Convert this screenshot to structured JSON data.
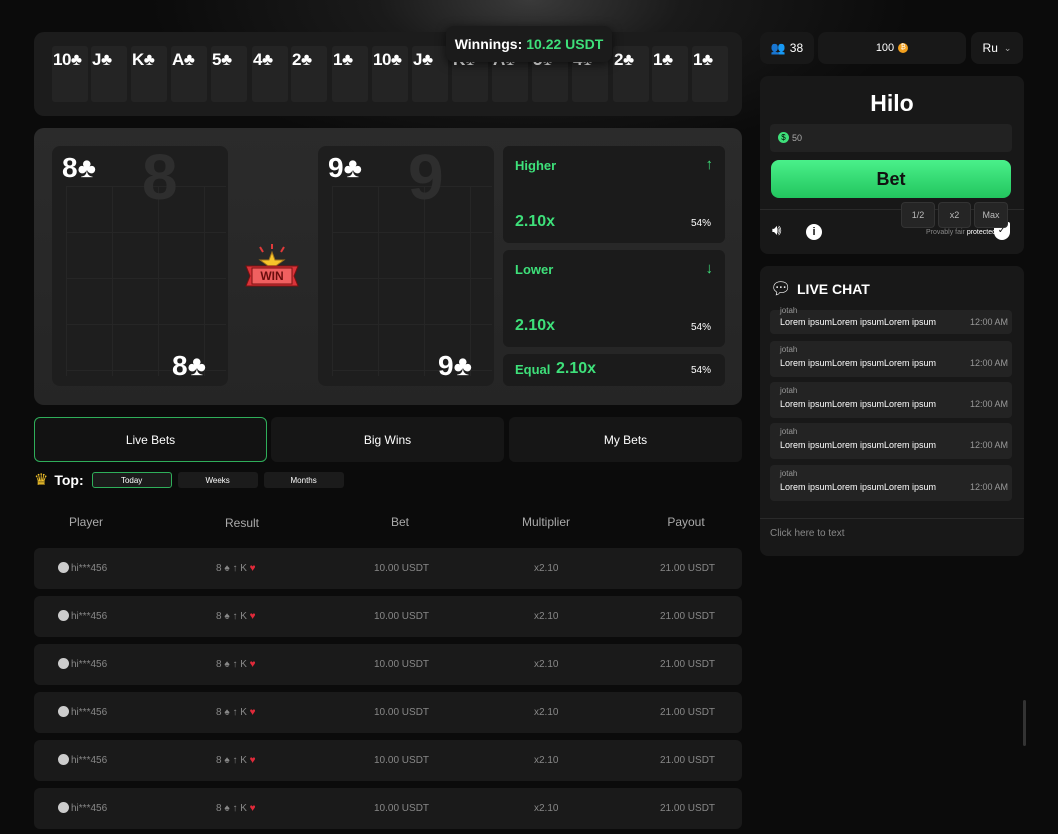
{
  "history": {
    "cards": [
      "10♣",
      "J♣",
      "K♣",
      "A♣",
      "5♣",
      "4♣",
      "2♣",
      "1♣",
      "10♣",
      "J♣",
      "K♣",
      "A♣",
      "5♣",
      "4♣",
      "2♣",
      "1♣",
      "1♣"
    ]
  },
  "winnings": {
    "label": "Winnings:",
    "value": "10.22 USDT"
  },
  "game": {
    "left_card": {
      "rank": "8",
      "suit": "♣",
      "label": "8♣"
    },
    "right_card": {
      "rank": "9",
      "suit": "♣",
      "label": "9♣"
    },
    "win_badge": "WIN",
    "higher": {
      "label": "Higher",
      "mult": "2.10x",
      "pct": "54%"
    },
    "lower": {
      "label": "Lower",
      "mult": "2.10x",
      "pct": "54%"
    },
    "equal": {
      "label": "Equal",
      "mult": "2.10x",
      "pct": "54%"
    }
  },
  "tabs": [
    "Live Bets",
    "Big Wins",
    "My Bets"
  ],
  "top": {
    "label": "Top:",
    "periods": [
      "Today",
      "Weeks",
      "Months"
    ]
  },
  "table": {
    "headers": [
      "Player",
      "Result",
      "Bet",
      "Multiplier",
      "Payout"
    ],
    "rows": [
      {
        "player": "hi***456",
        "result": "8",
        "result_to": "K",
        "bet": "10.00 USDT",
        "mult": "x2.10",
        "payout": "21.00 USDT"
      },
      {
        "player": "hi***456",
        "result": "8",
        "result_to": "K",
        "bet": "10.00 USDT",
        "mult": "x2.10",
        "payout": "21.00 USDT"
      },
      {
        "player": "hi***456",
        "result": "8",
        "result_to": "K",
        "bet": "10.00 USDT",
        "mult": "x2.10",
        "payout": "21.00 USDT"
      },
      {
        "player": "hi***456",
        "result": "8",
        "result_to": "K",
        "bet": "10.00 USDT",
        "mult": "x2.10",
        "payout": "21.00 USDT"
      },
      {
        "player": "hi***456",
        "result": "8",
        "result_to": "K",
        "bet": "10.00 USDT",
        "mult": "x2.10",
        "payout": "21.00 USDT"
      },
      {
        "player": "hi***456",
        "result": "8",
        "result_to": "K",
        "bet": "10.00 USDT",
        "mult": "x2.10",
        "payout": "21.00 USDT"
      }
    ]
  },
  "topbar": {
    "users": "38",
    "balance": "100",
    "lang": "Ru"
  },
  "hilo": {
    "title": "Hilo",
    "amount": "50",
    "half": "1/2",
    "double": "x2",
    "max": "Max",
    "bet": "Bet",
    "fair_text": "Provably fair",
    "fair_bold": "protected"
  },
  "chat": {
    "title": "LIVE CHAT",
    "messages": [
      {
        "user": "jotah",
        "text": "Lorem ipsumLorem ipsumLorem ipsum",
        "time": "12:00 AM"
      },
      {
        "user": "jotah",
        "text": "Lorem ipsumLorem ipsumLorem ipsum",
        "time": "12:00 AM"
      },
      {
        "user": "jotah",
        "text": "Lorem ipsumLorem ipsumLorem ipsum",
        "time": "12:00 AM"
      },
      {
        "user": "jotah",
        "text": "Lorem ipsumLorem ipsumLorem ipsum",
        "time": "12:00 AM"
      },
      {
        "user": "jotah",
        "text": "Lorem ipsumLorem ipsumLorem ipsum",
        "time": "12:00 AM"
      }
    ],
    "placeholder": "Click here to text"
  },
  "colors": {
    "accent": "#3ee07a",
    "heart": "#e02a3a",
    "coin": "#f2a01e"
  }
}
